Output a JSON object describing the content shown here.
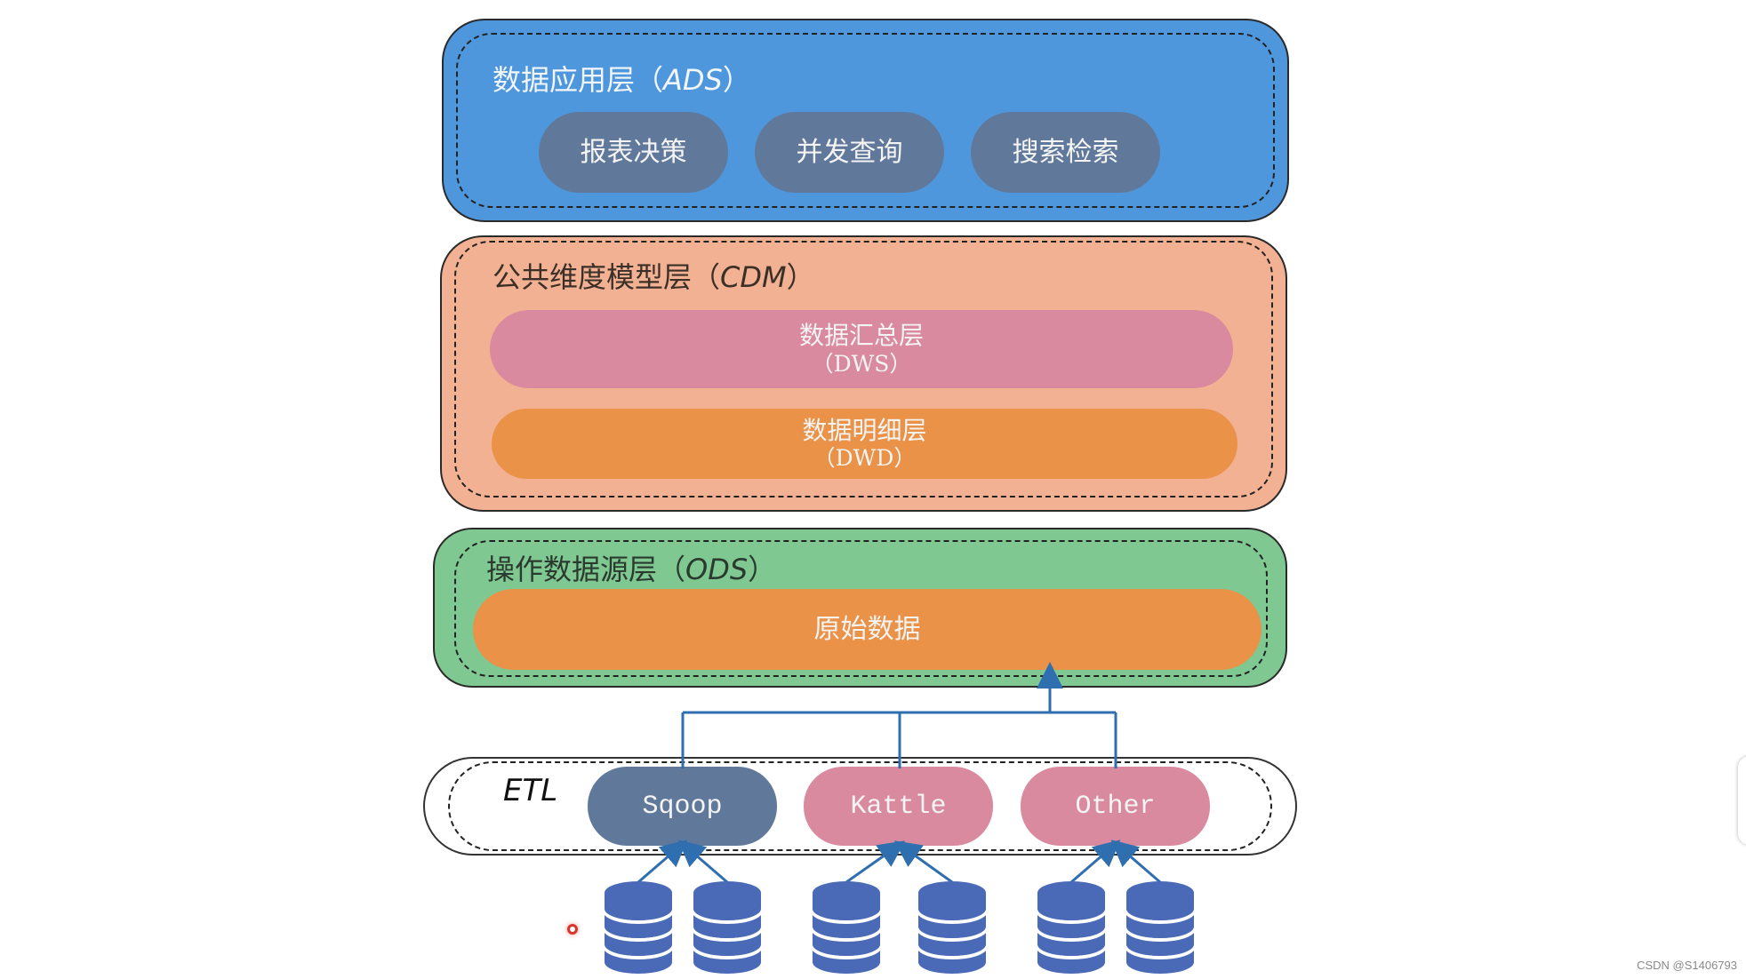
{
  "colors": {
    "ads_fill": "#4f97dc",
    "ads_pill": "#60799b",
    "cdm_fill": "#f2b193",
    "dws_pill": "#d98a9e",
    "dwd_pill": "#ea9247",
    "ods_fill": "#7fc891",
    "raw_pill": "#ea9247",
    "etl_fill": "#ffffff",
    "sqoop_pill": "#60799b",
    "kattle_pill": "#d98a9e",
    "other_pill": "#d98a9e",
    "connector": "#2f6fb0",
    "database": "#4a6ab8"
  },
  "ads": {
    "title": "数据应用层（",
    "abbr": "ADS",
    "close": "）",
    "items": [
      "报表决策",
      "并发查询",
      "搜索检索"
    ]
  },
  "cdm": {
    "title": "公共维度模型层（",
    "abbr": "CDM",
    "close": "）",
    "dws": {
      "line1": "数据汇总层",
      "line2": "（DWS）"
    },
    "dwd": {
      "line1": "数据明细层",
      "line2": "（DWD）"
    }
  },
  "ods": {
    "title": "操作数据源层（",
    "abbr": "ODS",
    "close": "）",
    "raw": "原始数据"
  },
  "etl": {
    "label": "ETL",
    "tools": [
      "Sqoop",
      "Kattle",
      "Other"
    ]
  },
  "databases": {
    "count": 6,
    "icon": "database-icon"
  },
  "watermark": "CSDN @S1406793"
}
